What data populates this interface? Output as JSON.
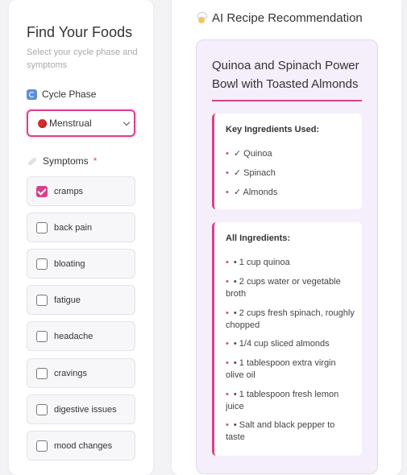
{
  "find": {
    "title": "Find Your Foods",
    "subtitle": "Select your cycle phase and symptoms"
  },
  "cycle": {
    "label": "Cycle Phase",
    "selected": "Menstrual"
  },
  "symptoms": {
    "label": "Symptoms",
    "required_marker": "*",
    "items": [
      {
        "label": "cramps",
        "checked": true
      },
      {
        "label": "back pain",
        "checked": false
      },
      {
        "label": "bloating",
        "checked": false
      },
      {
        "label": "fatigue",
        "checked": false
      },
      {
        "label": "headache",
        "checked": false
      },
      {
        "label": "cravings",
        "checked": false
      },
      {
        "label": "digestive issues",
        "checked": false
      },
      {
        "label": "mood changes",
        "checked": false
      }
    ]
  },
  "ai": {
    "title": "AI Recipe Recommendation",
    "recipe_name": "Quinoa and Spinach Power Bowl with Toasted Almonds",
    "key_heading": "Key Ingredients Used:",
    "key_items": [
      "✓ Quinoa",
      "✓ Spinach",
      "✓ Almonds"
    ],
    "all_heading": "All Ingredients:",
    "all_items": [
      "• 1 cup quinoa",
      "• 2 cups water or vegetable broth",
      "• 2 cups fresh spinach, roughly chopped",
      "• 1/4 cup sliced almonds",
      "• 1 tablespoon extra virgin olive oil",
      "• 1 tablespoon fresh lemon juice",
      "• Salt and black pepper to taste"
    ]
  },
  "colors": {
    "accent": "#d9408a",
    "panel": "#f5eefb"
  },
  "icons": {
    "cycle": "cycle-icon",
    "symptoms": "bandage-icon",
    "ai": "chef-icon",
    "phase": "red-circle-icon"
  }
}
